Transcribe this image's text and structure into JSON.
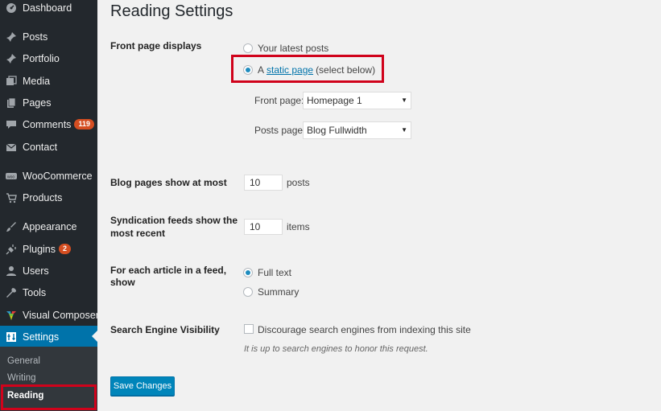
{
  "sidebar": {
    "items": [
      {
        "label": "Dashboard",
        "icon": "dashboard-icon"
      },
      {
        "label": "Posts",
        "icon": "pin-icon"
      },
      {
        "label": "Portfolio",
        "icon": "pin-icon"
      },
      {
        "label": "Media",
        "icon": "media-icon"
      },
      {
        "label": "Pages",
        "icon": "pages-icon"
      },
      {
        "label": "Comments",
        "icon": "comment-icon",
        "badge": "119"
      },
      {
        "label": "Contact",
        "icon": "mail-icon"
      },
      {
        "label": "WooCommerce",
        "icon": "woo-icon"
      },
      {
        "label": "Products",
        "icon": "cart-icon"
      },
      {
        "label": "Appearance",
        "icon": "brush-icon"
      },
      {
        "label": "Plugins",
        "icon": "plug-icon",
        "badge": "2"
      },
      {
        "label": "Users",
        "icon": "user-icon"
      },
      {
        "label": "Tools",
        "icon": "wrench-icon"
      },
      {
        "label": "Visual Composer",
        "icon": "vc-icon"
      },
      {
        "label": "Settings",
        "icon": "settings-icon"
      }
    ],
    "submenu": [
      "General",
      "Writing",
      "Reading"
    ]
  },
  "main": {
    "title": "Reading Settings",
    "front_page": {
      "label": "Front page displays",
      "option_latest": "Your latest posts",
      "option_static_prefix": "A",
      "option_static_link": "static page",
      "option_static_suffix": "(select below)",
      "front_page_label": "Front page:",
      "front_page_value": "Homepage 1",
      "posts_page_label": "Posts page:",
      "posts_page_value": "Blog Fullwidth",
      "selected": "static"
    },
    "blog_pages": {
      "label": "Blog pages show at most",
      "value": "10",
      "unit": "posts"
    },
    "syndication": {
      "label_line1": "Syndication feeds show the",
      "label_line2": "most recent",
      "value": "10",
      "unit": "items"
    },
    "feed_article": {
      "label_line1": "For each article in a feed,",
      "label_line2": "show",
      "option_full": "Full text",
      "option_summary": "Summary",
      "selected": "full"
    },
    "search_visibility": {
      "label": "Search Engine Visibility",
      "checkbox_label": "Discourage search engines from indexing this site",
      "description": "It is up to search engines to honor this request."
    },
    "save_label": "Save Changes"
  },
  "colors": {
    "sidebar": "#23282d",
    "active": "#0073aa",
    "highlight": "#d0021b",
    "badge": "#d54e21"
  }
}
